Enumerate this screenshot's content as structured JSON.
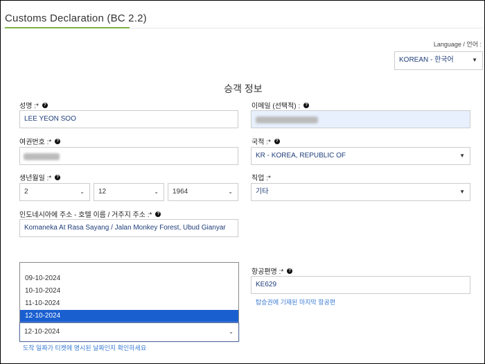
{
  "header": {
    "title": "Customs Declaration (BC 2.2)"
  },
  "language": {
    "label": "Language / 언어 :",
    "selected": "KOREAN  -  한국어",
    "caret_icon": "chevron-down-icon"
  },
  "section": {
    "title": "승객 정보"
  },
  "form": {
    "name": {
      "label": "성명 :*",
      "value": "LEE YEON SOO"
    },
    "email": {
      "label": "이메일 (선택적) :"
    },
    "passport": {
      "label": "여권번호 :*"
    },
    "nationality": {
      "label": "국적 :*",
      "value": "KR - KOREA, REPUBLIC OF"
    },
    "birthdate": {
      "label": "생년월일 :*",
      "day": "2",
      "month": "12",
      "year": "1964"
    },
    "occupation": {
      "label": "직업 :*",
      "value": "기타"
    },
    "address": {
      "label": "인도네시아에 주소 - 호텔 이름 / 거주지 주소 :*",
      "value": "Komaneka At Rasa Sayang / Jalan Monkey Forest, Ubud Gianyar"
    },
    "flight": {
      "label": "항공편명 :*",
      "value": "KE629",
      "hint": "탑승권에 기재된 마지막 항공편"
    },
    "arrival_date": {
      "options": [
        "09-10-2024",
        "10-10-2024",
        "11-10-2024",
        "12-10-2024"
      ],
      "selected": "12-10-2024",
      "hint": "도착 일짜가 티켓에 명시된 날짜인지 확인하세요"
    }
  },
  "colors": {
    "accent_underline": "#7cb342",
    "link_blue": "#3a7bd5",
    "selected_option_bg": "#1a5fd0",
    "autofill_bg": "#e8f0fe"
  }
}
